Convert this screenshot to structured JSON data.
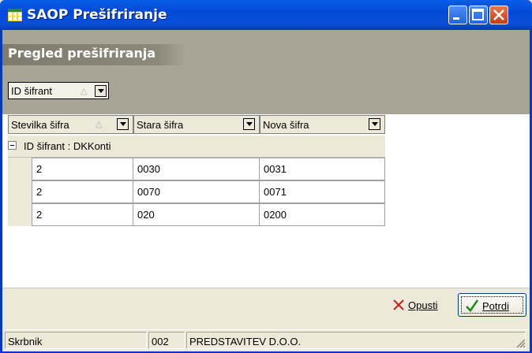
{
  "window": {
    "title": "SAOP Prešifriranje"
  },
  "panel": {
    "title": "Pregled prešifriranja"
  },
  "group_by": {
    "label": "ID šifrant",
    "sort_arrow": "△"
  },
  "table": {
    "columns": [
      {
        "label": "Stevilka šifra",
        "sort_arrow": "△"
      },
      {
        "label": "Stara šifra"
      },
      {
        "label": "Nova šifra"
      }
    ],
    "group_label": "ID šifrant : DKKonti",
    "rows": [
      [
        "2",
        "0030",
        "0031"
      ],
      [
        "2",
        "0070",
        "0071"
      ],
      [
        "2",
        "020",
        "0200"
      ]
    ]
  },
  "buttons": {
    "cancel": "Opusti",
    "confirm": "Potrdi"
  },
  "status": {
    "user": "Skrbnik",
    "company_code": "002",
    "company_name": "PREDSTAVITEV D.O.O."
  }
}
